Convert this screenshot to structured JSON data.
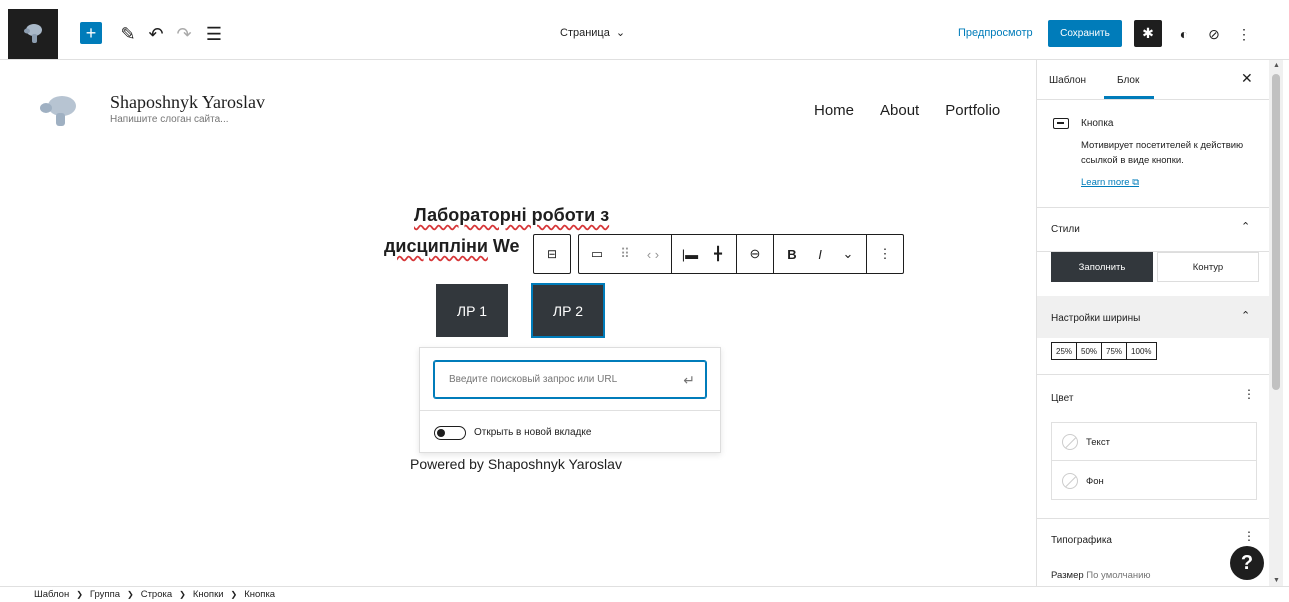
{
  "topbar": {
    "document_title": "Страница",
    "preview_label": "Предпросмотр",
    "save_label": "Сохранить"
  },
  "site": {
    "title": "Shaposhnyk Yaroslav",
    "tagline": "Напишите слоган сайта...",
    "nav": [
      "Home",
      "About",
      "Portfolio"
    ]
  },
  "content": {
    "heading_line1": "Лабораторні роботи з",
    "heading_line2_underlined": "дисципліни",
    "heading_line2_rest": " We",
    "buttons": [
      "ЛР 1",
      "ЛР 2"
    ],
    "footer": "Powered by Shaposhnyk Yaroslav"
  },
  "link_popover": {
    "placeholder": "Введите поисковый запрос или URL",
    "toggle_label": "Открыть в новой вкладке"
  },
  "sidebar": {
    "tabs": [
      "Шаблон",
      "Блок"
    ],
    "block": {
      "title": "Кнопка",
      "description": "Мотивирует посетителей к действию ссылкой в виде кнопки.",
      "learn_more": "Learn more"
    },
    "styles": {
      "title": "Стили",
      "options": [
        "Заполнить",
        "Контур"
      ]
    },
    "width": {
      "title": "Настройки ширины",
      "options": [
        "25%",
        "50%",
        "75%",
        "100%"
      ]
    },
    "color": {
      "title": "Цвет",
      "items": [
        "Текст",
        "Фон"
      ]
    },
    "typography": {
      "title": "Типографика",
      "size_label": "Размер",
      "size_value": "По умолчанию"
    }
  },
  "breadcrumbs": [
    "Шаблон",
    "Группа",
    "Строка",
    "Кнопки",
    "Кнопка"
  ],
  "colors": {
    "accent": "#007cba",
    "dark": "#1e1e1e",
    "button_bg": "#32373c"
  }
}
